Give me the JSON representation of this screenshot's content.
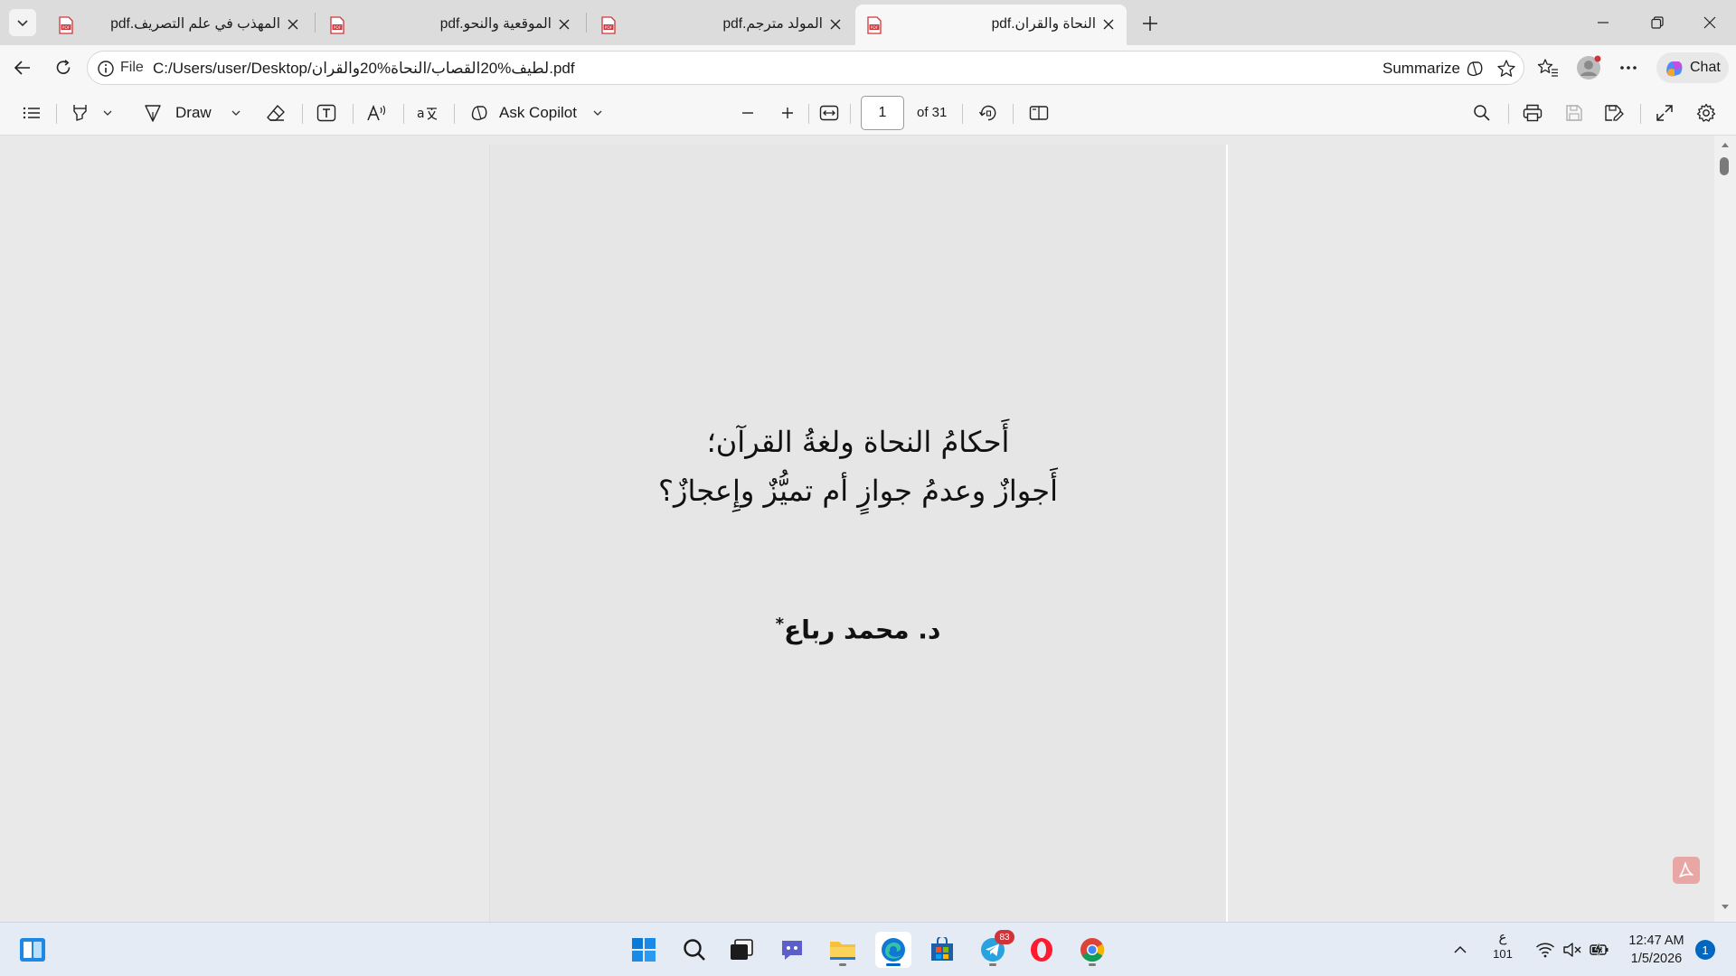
{
  "browser": {
    "tabs": [
      {
        "title": "المهذب في علم التصريف.pdf",
        "active": false
      },
      {
        "title": "الموقعية والنحو.pdf",
        "active": false
      },
      {
        "title": "المولد مترجم.pdf",
        "active": false
      },
      {
        "title": "النحاة والقران.pdf",
        "active": true
      }
    ],
    "address": {
      "scheme": "File",
      "url": "C:/Users/user/Desktop/لطيف%20القصاب/النحاة%20والقران.pdf",
      "summarize_label": "Summarize"
    },
    "chat_label": "Chat"
  },
  "pdf_toolbar": {
    "draw_label": "Draw",
    "ask_copilot_label": "Ask Copilot",
    "page_current": "1",
    "page_total_label": "of 31"
  },
  "document": {
    "title_line1": "أَحكامُ النحاة ولغةُ القرآن؛",
    "title_line2": "أَجوازٌ وعدمُ جوازٍ أم تميُّزٌ وإِعجازٌ؟",
    "author": "د. محمد رباع",
    "author_mark": "*"
  },
  "taskbar": {
    "telegram_badge": "83",
    "keyboard_layout": "ع",
    "keyboard_sub": "101",
    "time": "12:47 AM",
    "date": "1/5/2026",
    "notification_count": "1"
  },
  "colors": {
    "accent": "#0067c0",
    "pdf_red": "#d13438",
    "page_bg": "#e6e6e6"
  }
}
